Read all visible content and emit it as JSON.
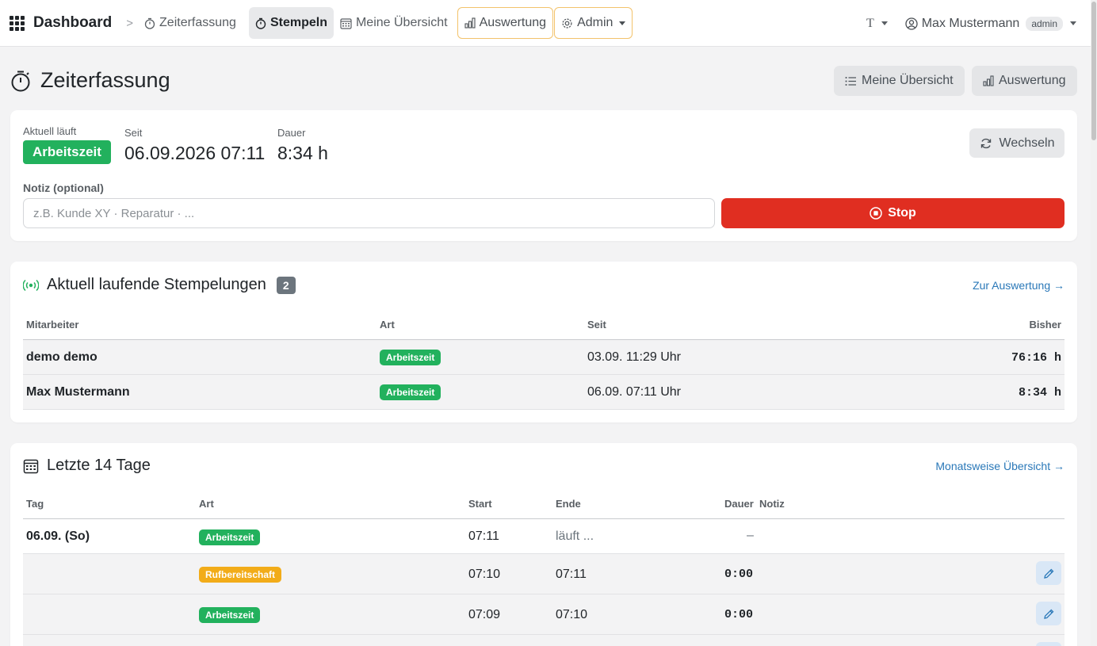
{
  "navbar": {
    "brand": "Dashboard",
    "breadcrumb": [
      "Zeiterfassung"
    ],
    "items": [
      {
        "label": "Stempeln",
        "icon": "stopwatch-icon",
        "active": true
      },
      {
        "label": "Meine Übersicht",
        "icon": "calendar-icon"
      },
      {
        "label": "Auswertung",
        "icon": "bar-chart-icon"
      },
      {
        "label": "Admin",
        "icon": "gear-icon"
      }
    ],
    "theme_label": "T",
    "user_name": "Max Mustermann",
    "user_role": "admin"
  },
  "page": {
    "title": "Zeiterfassung",
    "actions": [
      {
        "label": "Meine Übersicht",
        "icon": "list-icon"
      },
      {
        "label": "Auswertung",
        "icon": "bar-chart-icon"
      }
    ]
  },
  "current": {
    "running_label": "Aktuell läuft",
    "status": "Arbeitszeit",
    "since_label": "Seit",
    "since_value": "06.09.2026 07:11",
    "duration_label": "Dauer",
    "duration_value": "8:34 h",
    "switch_label": "Wechseln",
    "note_label": "Notiz (optional)",
    "note_placeholder": "z.B. Kunde XY · Reparatur · ...",
    "note_value": "",
    "stop_label": "Stop",
    "colors": {
      "status": "#22b15d",
      "stop": "#e02e21"
    }
  },
  "running": {
    "title": "Aktuell laufende Stempelungen",
    "count": "2",
    "link": "Zur Auswertung →",
    "columns": [
      "Mitarbeiter",
      "Art",
      "Seit",
      "Bisher"
    ],
    "rows": [
      {
        "name": "demo demo",
        "type": "Arbeitszeit",
        "since": "03.09. 11:29 Uhr",
        "so_far": "76:16 h"
      },
      {
        "name": "Max Mustermann",
        "type": "Arbeitszeit",
        "since": "06.09. 07:11 Uhr",
        "so_far": "8:34 h"
      }
    ]
  },
  "recent": {
    "title": "Letzte 14 Tage",
    "link": "Monatsweise Übersicht →",
    "columns": [
      "Tag",
      "Art",
      "Start",
      "Ende",
      "Dauer",
      "Notiz"
    ],
    "rows": [
      {
        "day": "06.09. (So)",
        "type": "Arbeitszeit",
        "type_color": "green",
        "start": "07:11",
        "end": "läuft ...",
        "duration": "–",
        "editable": false
      },
      {
        "day": "",
        "type": "Rufbereitschaft",
        "type_color": "amber",
        "start": "07:10",
        "end": "07:11",
        "duration": "0:00",
        "editable": true
      },
      {
        "day": "",
        "type": "Arbeitszeit",
        "type_color": "green",
        "start": "07:09",
        "end": "07:10",
        "duration": "0:00",
        "editable": true
      }
    ]
  }
}
